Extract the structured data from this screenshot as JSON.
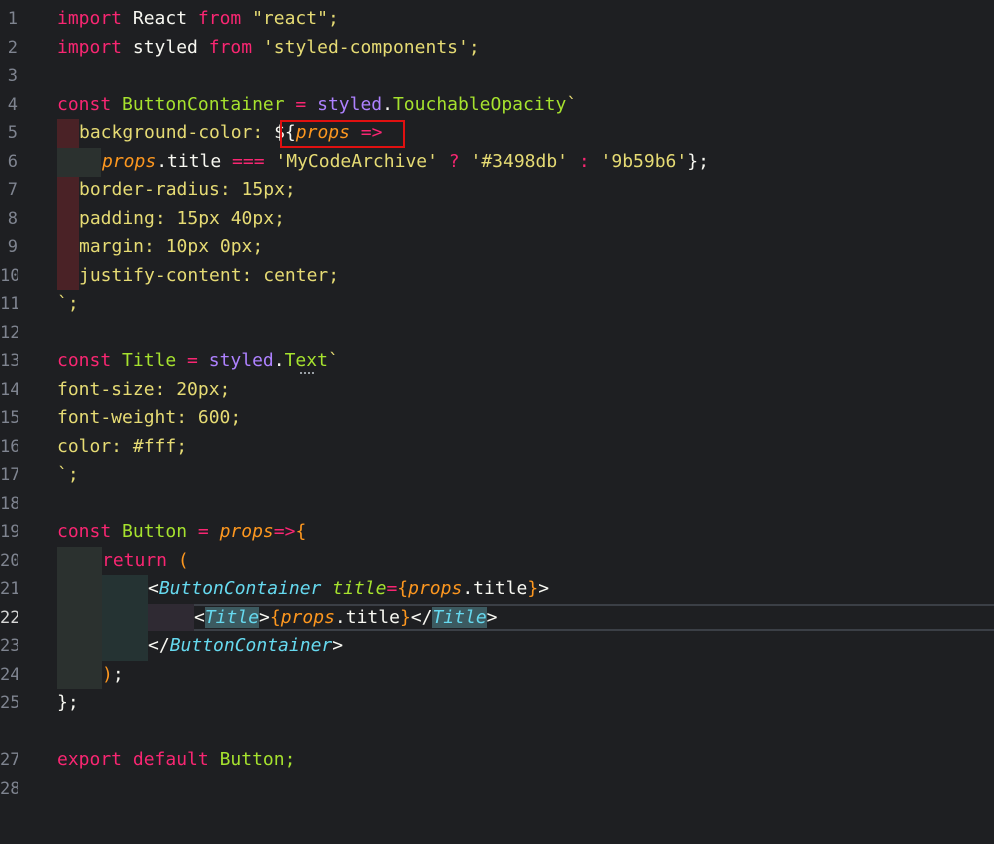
{
  "editor": {
    "active_line": "22",
    "line_numbers": [
      "1",
      "2",
      "3",
      "4",
      "5",
      "6",
      "7",
      "8",
      "9",
      "10",
      "11",
      "12",
      "13",
      "14",
      "15",
      "16",
      "17",
      "18",
      "19",
      "20",
      "21",
      "22",
      "23",
      "24",
      "25",
      "27",
      "28"
    ],
    "code": {
      "l1": {
        "a": "import",
        "b": " React ",
        "c": "from",
        "d": " \"react\";"
      },
      "l2": {
        "a": "import",
        "b": " styled ",
        "c": "from",
        "d": " 'styled-components';"
      },
      "l4": {
        "a": "const",
        "b": " ButtonContainer ",
        "c": "=",
        "d": " styled",
        "e": ".",
        "f": "TouchableOpacity",
        "g": "`"
      },
      "l5": {
        "a": "background-color: ",
        "b": "${",
        "c": "props",
        "d": " =>"
      },
      "l6": {
        "a": "props",
        "b": ".title ",
        "c": "===",
        "d": " 'MyCodeArchive' ",
        "e": "?",
        "f": " '#3498db' ",
        "g": ":",
        "h": " '9b59b6'",
        "i": "};"
      },
      "l7": "border-radius: 15px;",
      "l8": "padding: 15px 40px;",
      "l9": "margin: 10px 0px;",
      "l10": "justify-content: center;",
      "l11": "`;",
      "l13": {
        "a": "const",
        "b": " Title ",
        "c": "=",
        "d": " styled",
        "e": ".",
        "f": "Text",
        "g": "`"
      },
      "l14": "font-size: 20px;",
      "l15": "font-weight: 600;",
      "l16": "color: #fff;",
      "l17": "`;",
      "l19": {
        "a": "const",
        "b": " Button ",
        "c": "=",
        "d": " ",
        "e": "props",
        "f": "=>",
        "g": "{"
      },
      "l20": {
        "a": "return",
        "b": " ("
      },
      "l21": {
        "a": "<",
        "b": "ButtonContainer",
        "c": " title",
        "d": "=",
        "e": "{",
        "f": "props",
        "g": ".title",
        "h": "}",
        "i": ">"
      },
      "l22": {
        "a": "<",
        "b": "Title",
        "c": ">",
        "d": "{",
        "e": "props",
        "f": ".title",
        "g": "}",
        "h": "</",
        "i": "Title",
        "j": ">"
      },
      "l23": {
        "a": "</",
        "b": "ButtonContainer",
        "c": ">"
      },
      "l24": {
        "a": ")",
        "b": ";"
      },
      "l25": "};",
      "l27": {
        "a": "export",
        "b": " ",
        "c": "default",
        "d": " Button;"
      }
    }
  }
}
